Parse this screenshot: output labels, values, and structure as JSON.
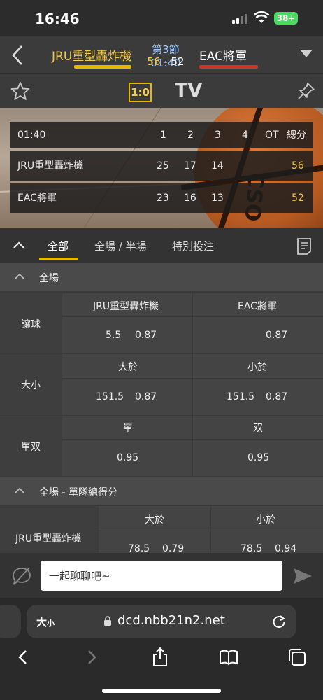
{
  "status_bar": {
    "time": "16:46",
    "battery": "38+"
  },
  "match": {
    "home_team": "JRU重型轟炸機",
    "away_team": "EAC將軍",
    "period": "第3節 01:40",
    "home_score": "56",
    "score_sep": " - ",
    "away_score": "52"
  },
  "toolbar": {
    "ratio_label": "1:0",
    "tv_label": "TV"
  },
  "scoreboard": {
    "header": [
      "01:40",
      "1",
      "2",
      "3",
      "4",
      "OT",
      "總分"
    ],
    "rows": [
      {
        "team": "JRU重型轟炸機",
        "q1": "25",
        "q2": "17",
        "q3": "14",
        "q4": "",
        "ot": "",
        "total": "56"
      },
      {
        "team": "EAC將軍",
        "q1": "23",
        "q2": "16",
        "q3": "13",
        "q4": "",
        "ot": "",
        "total": "52"
      }
    ],
    "ball_logo": "CSO"
  },
  "tabs": [
    {
      "label": "全部",
      "active": true
    },
    {
      "label": "全場 / 半場",
      "active": false
    },
    {
      "label": "特別投注",
      "active": false
    }
  ],
  "section_full": {
    "title": "全場",
    "handicap": {
      "label": "讓球",
      "col_home": "JRU重型轟炸機",
      "col_away": "EAC將軍",
      "home_line": "5.5",
      "home_odds": "0.87",
      "away_line": "",
      "away_odds": "0.87"
    },
    "total": {
      "label": "大小",
      "col_over": "大於",
      "col_under": "小於",
      "over_line": "151.5",
      "over_odds": "0.87",
      "under_line": "151.5",
      "under_odds": "0.87"
    },
    "odd_even": {
      "label": "單双",
      "col_odd": "單",
      "col_even": "双",
      "odd_odds": "0.95",
      "even_odds": "0.95"
    }
  },
  "section_team_total": {
    "title": "全場 - 單隊總得分",
    "team": "JRU重型轟炸機",
    "col_over": "大於",
    "col_under": "小於",
    "over_line": "78.5",
    "over_odds": "0.79",
    "under_line": "78.5",
    "under_odds": "0.94"
  },
  "chat": {
    "placeholder": "一起聊聊吧~"
  },
  "browser": {
    "text_size": "大",
    "text_size_small": "小",
    "url": "dcd.nbb21n2.net"
  },
  "colors": {
    "accent": "#e6b800",
    "away": "#c0392b",
    "odds": "#f2c94c"
  }
}
